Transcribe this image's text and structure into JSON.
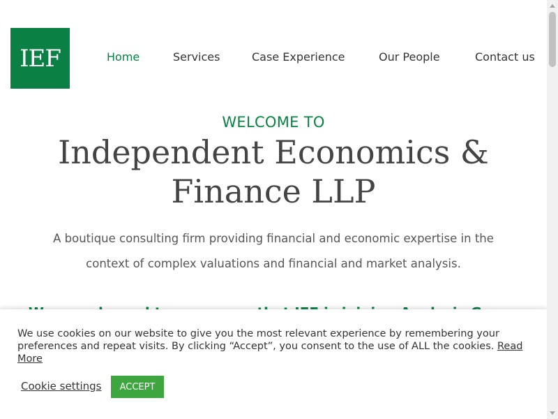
{
  "brand": {
    "logo_text": "IEF",
    "color": "#0a8044"
  },
  "nav": {
    "items": [
      {
        "label": "Home",
        "active": true
      },
      {
        "label": "Services"
      },
      {
        "label": "Case Experience"
      },
      {
        "label": "Our People"
      },
      {
        "label": "Contact us"
      }
    ]
  },
  "hero": {
    "kicker": "WELCOME TO",
    "title": "Independent Economics & Finance LLP",
    "description": "A boutique consulting firm providing financial and economic expertise in the context of complex valuations and financial and market analysis.",
    "highlight": "We are pleased to announce that IEF is joining Analysis Group"
  },
  "cookie": {
    "message": "We use cookies on our website to give you the most relevant experience by remembering your preferences and repeat visits. By clicking “Accept”, you consent to the use of ALL the cookies.",
    "read_more": "Read More",
    "settings_label": "Cookie settings",
    "accept_label": "ACCEPT",
    "accept_color": "#3da63f"
  }
}
